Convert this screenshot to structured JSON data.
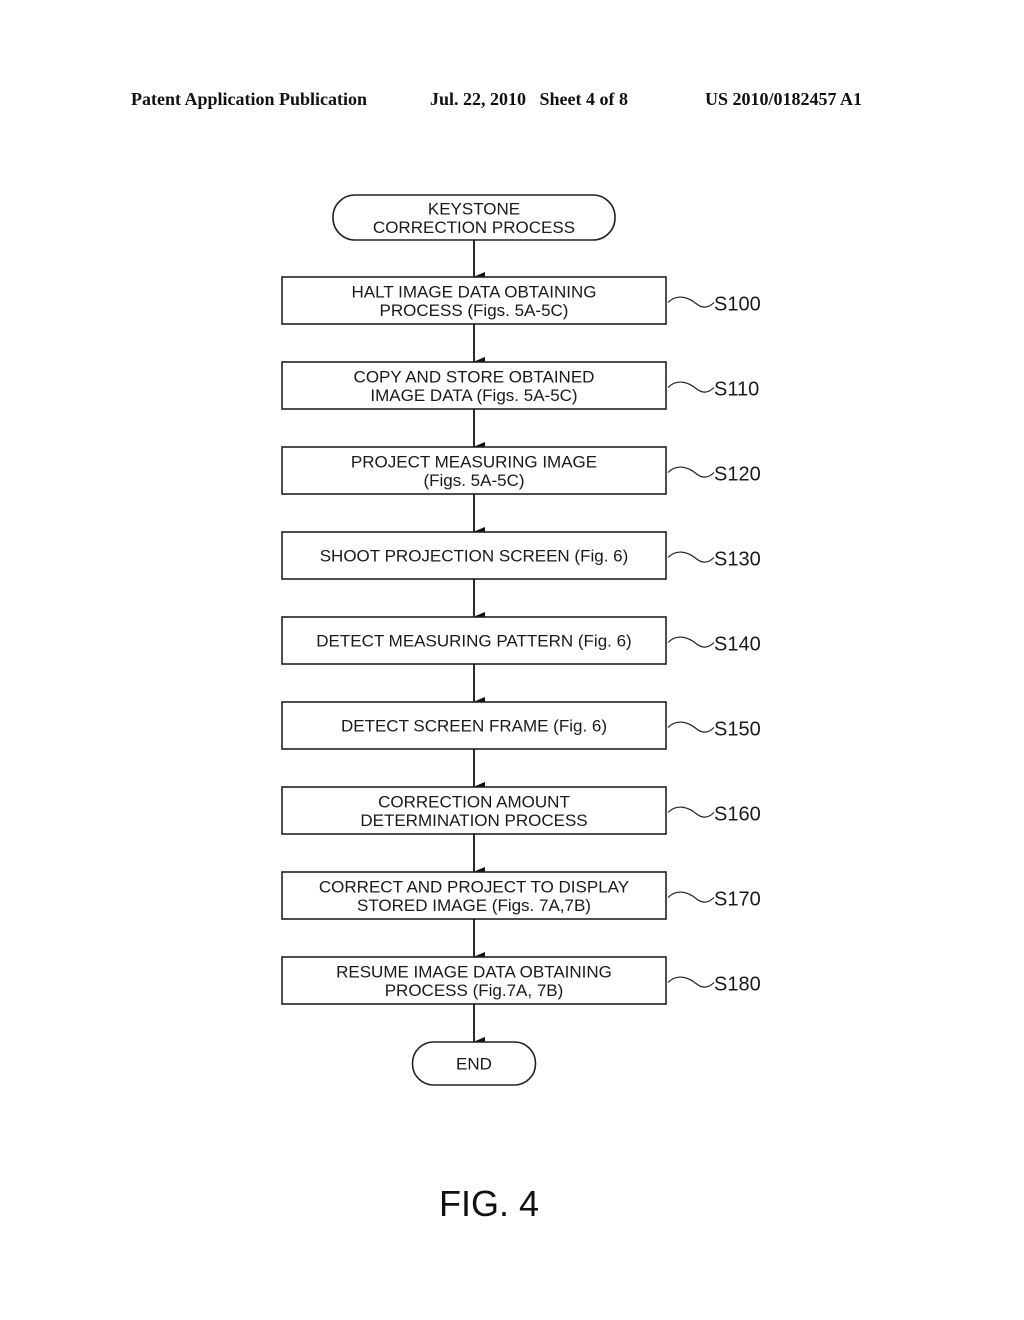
{
  "header": {
    "publication": "Patent Application Publication",
    "date_sheet": "Jul. 22, 2010   Sheet 4 of 8",
    "patent_number": "US 2010/0182457 A1"
  },
  "flowchart": {
    "start": {
      "lines": [
        "KEYSTONE",
        "CORRECTION PROCESS"
      ]
    },
    "steps": [
      {
        "id": "S100",
        "lines": [
          "HALT IMAGE DATA OBTAINING",
          "PROCESS (Figs. 5A-5C)"
        ]
      },
      {
        "id": "S110",
        "lines": [
          "COPY AND STORE OBTAINED",
          "IMAGE DATA (Figs. 5A-5C)"
        ]
      },
      {
        "id": "S120",
        "lines": [
          "PROJECT MEASURING IMAGE",
          "(Figs. 5A-5C)"
        ]
      },
      {
        "id": "S130",
        "lines": [
          "SHOOT PROJECTION SCREEN (Fig. 6)"
        ]
      },
      {
        "id": "S140",
        "lines": [
          "DETECT MEASURING PATTERN (Fig. 6)"
        ]
      },
      {
        "id": "S150",
        "lines": [
          "DETECT SCREEN FRAME (Fig. 6)"
        ]
      },
      {
        "id": "S160",
        "lines": [
          "CORRECTION AMOUNT",
          "DETERMINATION PROCESS"
        ]
      },
      {
        "id": "S170",
        "lines": [
          "CORRECT AND PROJECT TO DISPLAY",
          "STORED IMAGE (Figs. 7A,7B)"
        ]
      },
      {
        "id": "S180",
        "lines": [
          "RESUME IMAGE DATA OBTAINING",
          "PROCESS (Fig.7A, 7B)"
        ]
      }
    ],
    "end": {
      "lines": [
        "END"
      ]
    }
  },
  "figure_label": "FIG. 4"
}
